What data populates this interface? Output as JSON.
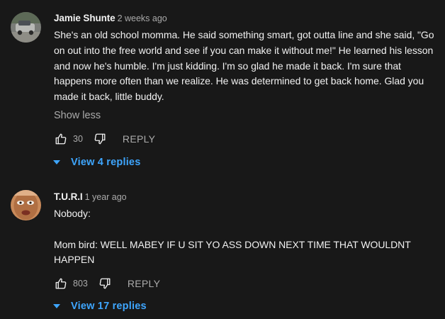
{
  "comments": [
    {
      "author": "Jamie Shunte",
      "time": "2 weeks ago",
      "text": "She's an old school momma. He said something smart, got outta line and she said, \"Go on out into the free world and see if you can make it without me!\" He learned his lesson and now he's humble. I'm just kidding. I'm so glad he made it back. I'm sure that happens more often than we realize. He was determined to get back home. Glad you made it back, little buddy.",
      "show_less": "Show less",
      "likes": "30",
      "reply_label": "REPLY",
      "view_replies": "View 4 replies"
    },
    {
      "author": "T.U.R.I",
      "time": "1 year ago",
      "text": "Nobody:\n\nMom bird: WELL MABEY IF U SIT YO ASS DOWN NEXT TIME THAT WOULDNT HAPPEN",
      "likes": "803",
      "reply_label": "REPLY",
      "view_replies": "View 17 replies"
    }
  ],
  "colors": {
    "background": "#181818",
    "text_primary": "#f1f1f1",
    "text_secondary": "#aaaaaa",
    "link": "#3ea6ff"
  },
  "icons": {
    "like": "thumbs-up-icon",
    "dislike": "thumbs-down-icon",
    "expand": "caret-down-icon"
  }
}
